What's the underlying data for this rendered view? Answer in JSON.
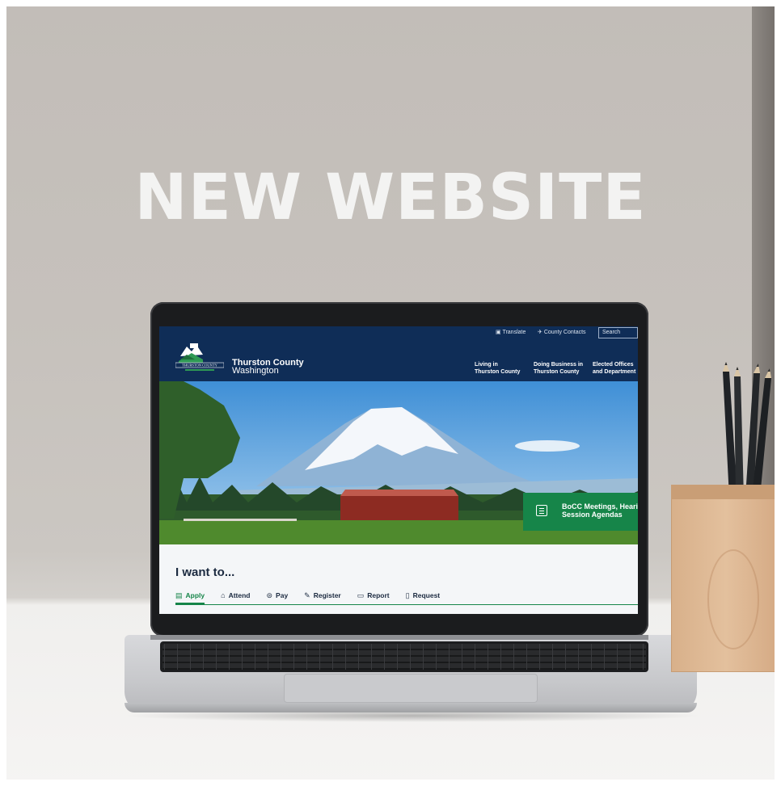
{
  "headline": "NEW WEBSITE",
  "website": {
    "utility": {
      "translate_label": "Translate",
      "contacts_label": "County Contacts",
      "search_placeholder": "Search"
    },
    "brand": {
      "line1": "Thurston County",
      "line2": "Washington",
      "logo_text": "THURSTON COUNTY"
    },
    "nav": [
      {
        "line1": "Living in",
        "line2": "Thurston County"
      },
      {
        "line1": "Doing Business in",
        "line2": "Thurston County"
      },
      {
        "line1": "Elected Offices",
        "line2": "and Department"
      }
    ],
    "hero_card": {
      "line1": "BoCC Meetings, Hearin",
      "line2": "Session Agendas",
      "icon": "document-icon"
    },
    "i_want": {
      "title": "I want to...",
      "tabs": [
        {
          "label": "Apply",
          "icon": "clipboard-icon",
          "active": true
        },
        {
          "label": "Attend",
          "icon": "people-icon",
          "active": false
        },
        {
          "label": "Pay",
          "icon": "pay-icon",
          "active": false
        },
        {
          "label": "Register",
          "icon": "register-icon",
          "active": false
        },
        {
          "label": "Report",
          "icon": "speech-bubble-icon",
          "active": false
        },
        {
          "label": "Request",
          "icon": "document-icon",
          "active": false
        }
      ]
    },
    "colors": {
      "header_navy": "#0f2d57",
      "accent_green": "#168549"
    }
  }
}
